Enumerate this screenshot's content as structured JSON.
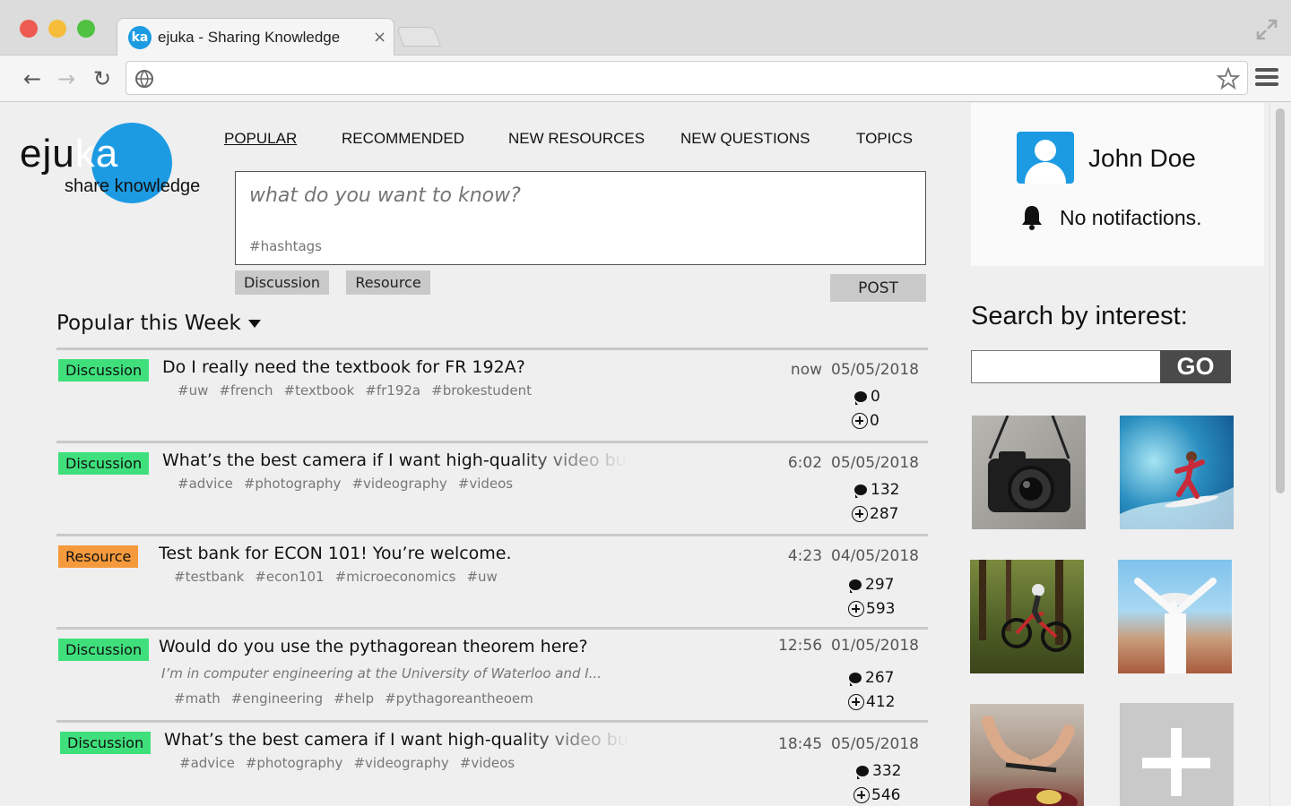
{
  "browser": {
    "tab_favicon": "ka",
    "tab_title": "ejuka - Sharing Knowledge",
    "tab_close": "×",
    "url": ""
  },
  "logo": {
    "word_dark": "eju",
    "word_light": "ka",
    "tagline": "share knowledge",
    "accent_color": "#1c9be3"
  },
  "nav": {
    "items": [
      "POPULAR",
      "RECOMMENDED",
      "NEW RESOURCES",
      "NEW QUESTIONS",
      "TOPICS"
    ],
    "active": "POPULAR"
  },
  "ask": {
    "placeholder": "what do you want to know?",
    "hashtags_placeholder": "#hashtags",
    "type_discussion": "Discussion",
    "type_resource": "Resource",
    "post_label": "POST"
  },
  "feed": {
    "title": "Popular this Week",
    "posts": [
      {
        "type": "Discussion",
        "title": "Do I really need the textbook for FR 192A?",
        "time": "now",
        "date": "05/05/2018",
        "tags": [
          "#uw",
          "#french",
          "#textbook",
          "#fr192a",
          "#brokestudent"
        ],
        "comments": "0",
        "plus": "0"
      },
      {
        "type": "Discussion",
        "title": "What’s the best camera if I want high-quality video but d",
        "time": "6:02",
        "date": "05/05/2018",
        "tags": [
          "#advice",
          "#photography",
          "#videography",
          "#videos"
        ],
        "comments": "132",
        "plus": "287"
      },
      {
        "type": "Resource",
        "title": "Test bank for ECON 101! You’re welcome.",
        "time": "4:23",
        "date": "04/05/2018",
        "tags": [
          "#testbank",
          "#econ101",
          "#microeconomics",
          "#uw"
        ],
        "comments": "297",
        "plus": "593"
      },
      {
        "type": "Discussion",
        "title": "Would do you use the pythagorean theorem here?",
        "snippet": "I’m in computer engineering at the University of Waterloo and I...",
        "time": "12:56",
        "date": "01/05/2018",
        "tags": [
          "#math",
          "#engineering",
          "#help",
          "#pythagoreantheoem"
        ],
        "comments": "267",
        "plus": "412"
      },
      {
        "type": "Discussion",
        "title": "What’s the best camera if I want high-quality video but d",
        "time": "18:45",
        "date": "05/05/2018",
        "tags": [
          "#advice",
          "#photography",
          "#videography",
          "#videos"
        ],
        "comments": "332",
        "plus": "546"
      }
    ]
  },
  "profile": {
    "name": "John Doe",
    "notifications": "No notifactions."
  },
  "interest": {
    "title": "Search by interest:",
    "input_value": "",
    "go_label": "GO",
    "tiles": [
      "camera-photo",
      "surfing-photo",
      "mountain-biking-photo",
      "travel-photo",
      "cooking-photo",
      "add-interest-icon"
    ]
  },
  "colors": {
    "discussion_badge": "#3fe07c",
    "resource_badge": "#f59a3c",
    "brand_blue": "#1c9be3"
  }
}
